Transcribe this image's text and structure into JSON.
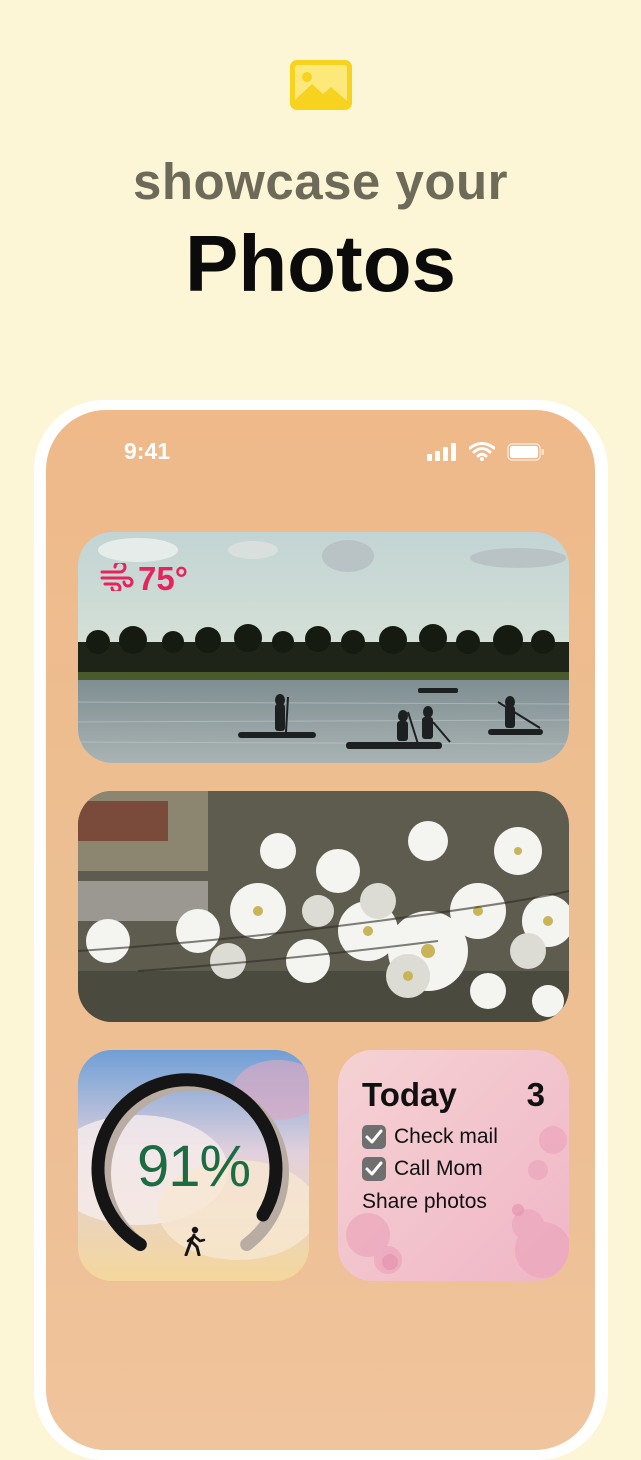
{
  "header": {
    "subtitle": "showcase your",
    "title": "Photos",
    "icon": "photo-icon",
    "icon_color": "#f7d21e"
  },
  "status_bar": {
    "time": "9:41",
    "icons": [
      "cellular-signal-icon",
      "wifi-icon",
      "battery-icon"
    ]
  },
  "widgets": {
    "weather": {
      "icon": "wind-icon",
      "temperature": "75°",
      "color": "#e5245e"
    },
    "lake_photo": {
      "description": "paddleboarders-on-lake"
    },
    "flowers_photo": {
      "description": "white-dogwood-blossoms"
    },
    "activity": {
      "value": "91%",
      "progress": 0.91,
      "icon": "walking-icon",
      "color": "#1d6b43"
    },
    "todo": {
      "title": "Today",
      "count": "3",
      "items": [
        {
          "label": "Check mail",
          "checked": true
        },
        {
          "label": "Call Mom",
          "checked": true
        },
        {
          "label": "Share photos",
          "checked": false
        }
      ]
    }
  }
}
